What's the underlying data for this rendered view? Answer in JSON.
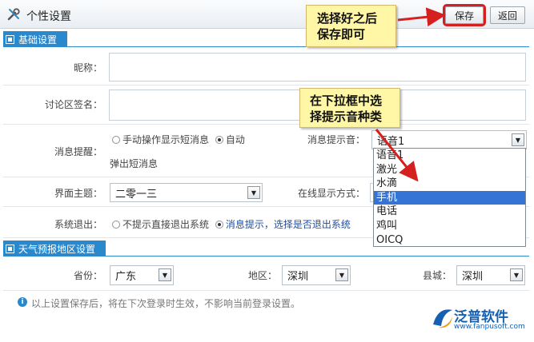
{
  "window": {
    "title": "个性设置"
  },
  "toolbar": {
    "save_label": "保存",
    "back_label": "返回"
  },
  "sections": {
    "basic": "基础设置",
    "weather": "天气预报地区设置"
  },
  "form": {
    "nickname": {
      "label": "昵称：",
      "value": ""
    },
    "signature": {
      "label": "讨论区签名：",
      "value": ""
    },
    "reminder": {
      "label": "消息提醒：",
      "opt_manual": "手动操作显示短消息",
      "opt_auto": "自动",
      "opt_auto_cont": "弹出短消息",
      "selected": "auto"
    },
    "sound": {
      "label": "消息提示音：",
      "value": "语音1",
      "options": [
        "语音1",
        "激光",
        "水滴",
        "手机",
        "电话",
        "鸡叫",
        "OICQ"
      ],
      "highlighted": "手机"
    },
    "theme": {
      "label": "界面主题：",
      "value": "二零一三"
    },
    "online": {
      "label": "在线显示方式："
    },
    "exit": {
      "label": "系统退出：",
      "opt_direct": "不提示直接退出系统",
      "opt_prompt": "消息提示，选择是否退出系统",
      "selected": "prompt"
    },
    "province": {
      "label": "省份：",
      "value": "广东"
    },
    "region": {
      "label": "地区：",
      "value": "深圳"
    },
    "county": {
      "label": "县城：",
      "value": "深圳"
    }
  },
  "note": "以上设置保存后，将在下次登录时生效，不影响当前登录设置。",
  "callouts": {
    "save_line1": "选择好之后",
    "save_line2": "保存即可",
    "sound_line1": "在下拉框中选",
    "sound_line2": "择提示音种类"
  },
  "logo": {
    "text": "泛普软件",
    "url": "www.fanpusoft.com"
  },
  "colors": {
    "accent": "#2a88cc",
    "highlight": "#3574d4",
    "callout": "#fff7a6",
    "arrow": "#d62020"
  }
}
